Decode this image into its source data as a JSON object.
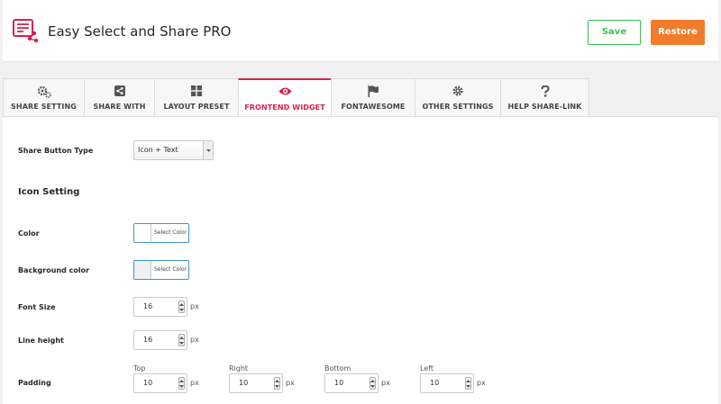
{
  "header": {
    "title": "Easy Select and Share PRO",
    "save_label": "Save",
    "restore_label": "Restore",
    "accent": "#d8224d",
    "save_color": "#3bbf56",
    "restore_color": "#f27b2b"
  },
  "tabs": [
    {
      "label": "SHARE SETTING",
      "icon": "gears-icon",
      "active": false
    },
    {
      "label": "SHARE WITH",
      "icon": "share-icon",
      "active": false
    },
    {
      "label": "LAYOUT PRESET",
      "icon": "grid-icon",
      "active": false
    },
    {
      "label": "FRONTEND WIDGET",
      "icon": "eye-icon",
      "active": true
    },
    {
      "label": "FONTAWESOME",
      "icon": "flag-icon",
      "active": false
    },
    {
      "label": "OTHER SETTINGS",
      "icon": "gear-icon",
      "active": false
    },
    {
      "label": "HELP SHARE-LINK",
      "icon": "question-icon",
      "active": false
    }
  ],
  "form": {
    "share_button_type_label": "Share Button Type",
    "share_button_type_value": "Icon + Text",
    "icon_setting_title": "Icon Setting",
    "color_label": "Color",
    "color_button": "Select Color",
    "bg_color_label": "Background color",
    "bg_color_button": "Select Color",
    "font_size_label": "Font Size",
    "font_size_value": "16",
    "font_size_unit": "px",
    "line_height_label": "Line height",
    "line_height_value": "16",
    "line_height_unit": "px",
    "padding_label": "Padding",
    "padding": {
      "top_label": "Top",
      "top_value": "10",
      "right_label": "Right",
      "right_value": "10",
      "bottom_label": "Bottom",
      "bottom_value": "10",
      "left_label": "Left",
      "left_value": "10",
      "unit": "px"
    }
  }
}
